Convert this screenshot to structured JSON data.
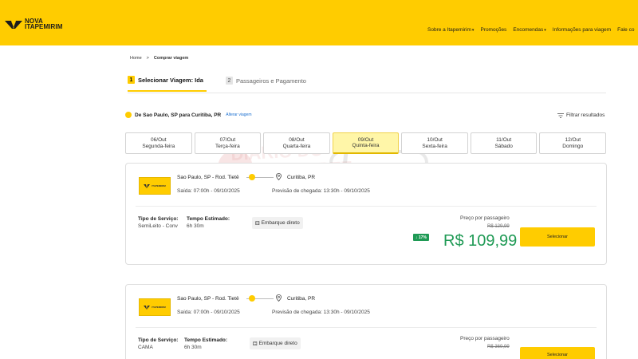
{
  "header": {
    "logo_line1": "NOVA",
    "logo_line2": "ITAPEMIRIM",
    "nav": [
      {
        "label": "Sobre a Itapemirim",
        "caret": "▾"
      },
      {
        "label": "Promoções",
        "caret": ""
      },
      {
        "label": "Encomendas",
        "caret": "▾"
      },
      {
        "label": "Informações para viagem",
        "caret": ""
      },
      {
        "label": "Fale co",
        "caret": ""
      }
    ],
    "accent_color": "#ffcc00"
  },
  "breadcrumb": {
    "home": "Home",
    "separator": ">",
    "current": "Comprar viagem"
  },
  "steps": [
    {
      "num": "1",
      "label": "Selecionar Viagem: Ida"
    },
    {
      "num": "2",
      "label": "Passageiros e Pagamento"
    }
  ],
  "route": {
    "text": "De Sao Paulo, SP para Curitiba, PR",
    "change_link": "Alterar viagem"
  },
  "filter_label": "Filtrar resultados",
  "dates": [
    {
      "date": "06/Out",
      "day": "Segunda-feira"
    },
    {
      "date": "07/Out",
      "day": "Terça-feira"
    },
    {
      "date": "08/Out",
      "day": "Quarta-feira"
    },
    {
      "date": "09/Out",
      "day": "Quinta-feira"
    },
    {
      "date": "10/Out",
      "day": "Sexta-feira"
    },
    {
      "date": "11/Out",
      "day": "Sábado"
    },
    {
      "date": "12/Out",
      "day": "Domingo"
    }
  ],
  "trips": [
    {
      "logo_text": "ITAPEMIRIM",
      "origin": "Sao Paulo, SP - Rod. Tietê",
      "departure": "Saída: 07:00h - 09/10/2025",
      "destination": "Curitiba, PR",
      "arrival": "Previsão de chegada: 13:30h - 09/10/2025",
      "service_label": "Tipo de Serviço:",
      "service_value": "SemiLeito - Conv",
      "time_label": "Tempo Estimado:",
      "time_value": "6h 30m",
      "boarding": "Embarque direto",
      "price_label": "Preço por passageiro",
      "old_price": "R$ 129,99",
      "discount": "↓ 17%",
      "price": "R$ 109,99",
      "button": "Selecionar"
    },
    {
      "logo_text": "ITAPEMIRIM",
      "origin": "Sao Paulo, SP - Rod. Tietê",
      "departure": "Saída: 07:00h - 09/10/2025",
      "destination": "Curitiba, PR",
      "arrival": "Previsão de chegada: 13:30h - 09/10/2025",
      "service_label": "Tipo de Serviço:",
      "service_value": "CAMA",
      "time_label": "Tempo Estimado:",
      "time_value": "6h 30m",
      "boarding": "Embarque direto",
      "price_label": "Preço por passageiro",
      "old_price": "R$ 369,99",
      "button": "Selecionar"
    }
  ],
  "watermark": {
    "line1": "DIÁRIO DO",
    "line2": "TRANSPORTE"
  }
}
